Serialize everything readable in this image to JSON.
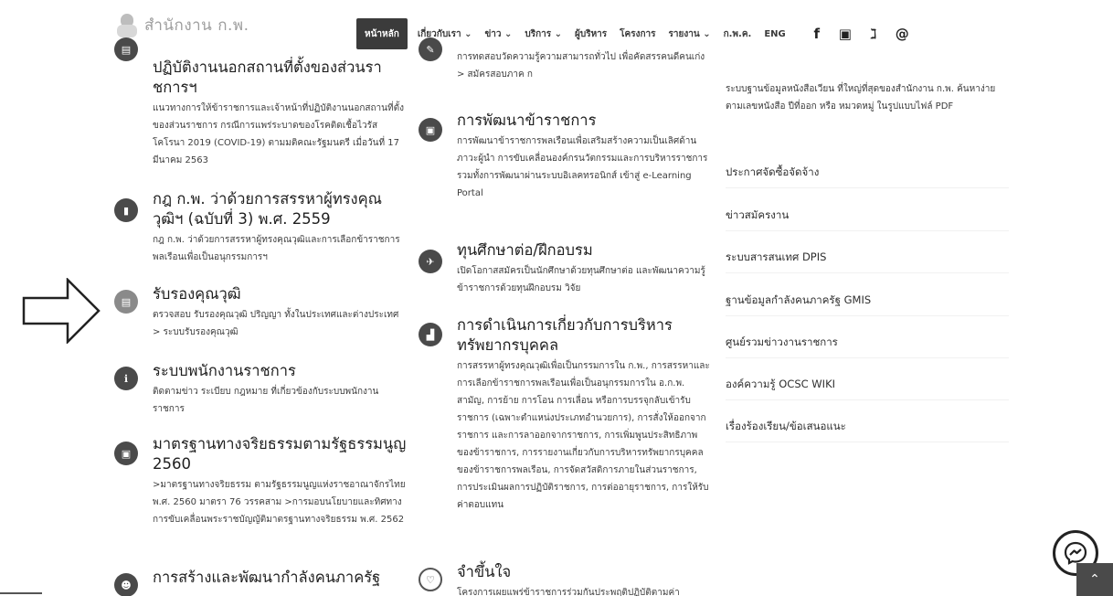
{
  "header": {
    "logo_text": "สำนักงาน ก.พ.",
    "nav": [
      {
        "label": "หน้าหลัก",
        "active": true
      },
      {
        "label": "เกี่ยวกับเรา ⌄",
        "active": false
      },
      {
        "label": "ข่าว ⌄",
        "active": false
      },
      {
        "label": "บริการ ⌄",
        "active": false
      },
      {
        "label": "ผู้บริหาร",
        "active": false
      },
      {
        "label": "โครงการ",
        "active": false
      },
      {
        "label": "รายงาน ⌄",
        "active": false
      },
      {
        "label": "ก.พ.ค.",
        "active": false
      },
      {
        "label": "ENG",
        "active": false
      }
    ],
    "social": [
      {
        "icon": "facebook-icon",
        "glyph": "f"
      },
      {
        "icon": "youtube-icon",
        "glyph": "▣"
      },
      {
        "icon": "rss-icon",
        "glyph": "ℷ"
      },
      {
        "icon": "email-icon",
        "glyph": "@"
      }
    ]
  },
  "col1": [
    {
      "icon": "document-icon",
      "title": "ปฏิบัติงานนอกสถานที่ตั้งของส่วนราชการฯ",
      "desc": "แนวทางการให้ข้าราชการและเจ้าหน้าที่ปฏิบัติงานนอกสถานที่ตั้งของส่วนราชการ กรณีการแพร่ระบาดของโรคติดเชื้อไวรัสโคโรนา 2019 (COVID-19) ตามมติคณะรัฐมนตรี เมื่อวันที่ 17 มีนาคม 2563"
    },
    {
      "icon": "file-icon",
      "title": "กฎ ก.พ. ว่าด้วยการสรรหาผู้ทรงคุณวุฒิฯ (ฉบับที่ 3) พ.ศ. 2559",
      "desc": "กฎ ก.พ. ว่าด้วยการสรรหาผู้ทรงคุณวุฒิและการเลือกข้าราชการพลเรือนเพื่อเป็นอนุกรรมการฯ"
    },
    {
      "icon": "certificate-icon",
      "title": "รับรองคุณวุฒิ",
      "desc": "ตรวจสอบ รับรองคุณวุฒิ ปริญญา ทั้งในประเทศและต่างประเทศ > ระบบรับรองคุณวุฒิ"
    },
    {
      "icon": "info-icon",
      "title": "ระบบพนักงานราชการ",
      "desc": "ติดตามข่าว ระเบียบ กฎหมาย ที่เกี่ยวข้องกับระบบพนักงานราชการ"
    },
    {
      "icon": "ethics-icon",
      "title": "มาตรฐานทางจริยธรรมตามรัฐธรรมนูญ 2560",
      "desc": ">มาตรฐานทางจริยธรรม ตามรัฐธรรมนูญแห่งราชอาณาจักรไทย พ.ศ. 2560 มาตรา 76 วรรคสาม >การมอบนโยบายและทิศทางการขับเคลื่อนพระราชบัญญัติมาตรฐานทางจริยธรรม พ.ศ. 2562"
    },
    {
      "icon": "people-icon",
      "title": "การสร้างและพัฒนากำลังคนภาครัฐ",
      "desc": ""
    }
  ],
  "col2": [
    {
      "icon": "exam-icon",
      "title": "",
      "desc": "การทดสอบวัดความรู้ความสามารถทั่วไป เพื่อคัดสรรคนดีคนเก่ง > สมัครสอบภาค ก"
    },
    {
      "icon": "training-icon",
      "title": "การพัฒนาข้าราชการ",
      "desc": "การพัฒนาข้าราชการพลเรือนเพื่อเสริมสร้างความเป็นเลิศด้านภาวะผู้นำ การขับเคลื่อนองค์กรนวัตกรรมและการบริหารราชการ รวมทั้งการพัฒนาผ่านระบบอิเลคทรอนิกส์ เข้าสู่ e-Learning Portal"
    },
    {
      "icon": "plane-icon",
      "title": "ทุนศึกษาต่อ/ฝึกอบรม",
      "desc": "เปิดโอกาสสมัครเป็นนักศึกษาด้วยทุนศึกษาต่อ และพัฒนาความรู้ข้าราชการด้วยทุนฝึกอบรม วิจัย"
    },
    {
      "icon": "chart-icon",
      "title": "การดำเนินการเกี่ยวกับการบริหารทรัพยากรบุคคล",
      "desc": "การสรรหาผู้ทรงคุณวุฒิเพื่อเป็นกรรมการใน ก.พ., การสรรหาและการเลือกข้าราชการพลเรือนเพื่อเป็นอนุกรรมการใน อ.ก.พ. สามัญ, การย้าย การโอน การเลื่อน หรือการบรรจุกลับเข้ารับราชการ (เฉพาะตำแหน่งประเภทอำนวยการ), การสั่งให้ออกจากราชการ และการลาออกจากราชการ, การเพิ่มพูนประสิทธิภาพของข้าราชการ, การรายงานเกี่ยวกับการบริหารทรัพยากรบุคคลของข้าราชการพลเรือน, การจัดสวัสดิการภายในส่วนราชการ, การประเมินผลการปฏิบัติราชการ, การต่ออายุราชการ, การให้รับค่าตอบแทน"
    },
    {
      "icon": "heart-icon",
      "title": "จำขึ้นใจ",
      "desc": "โครงการเผยแพร่ข้าราชการร่วมกันประพฤติปฏิบัติตามค่า"
    }
  ],
  "sidebar": {
    "lead": "ระบบฐานข้อมูลหนังสือเวียน ที่ใหญ่ที่สุดของสำนักงาน ก.พ. ค้นหาง่ายตามเลขหนังสือ ปีที่ออก หรือ หมวดหมู่ ในรูปแบบไฟล์ PDF",
    "items": [
      "ประกาศจัดซื้อจัดจ้าง",
      "ข่าวสมัครงาน",
      "ระบบสารสนเทศ DPIS",
      "ฐานข้อมูลกำลังคนภาครัฐ GMIS",
      "ศูนย์รวมข่าวงานราชการ",
      "องค์ความรู้ OCSC WIKI",
      "เรื่องร้องเรียน/ข้อเสนอแนะ"
    ]
  },
  "floating": {
    "chat_icon": "messenger-icon",
    "top_glyph": "⌃"
  }
}
